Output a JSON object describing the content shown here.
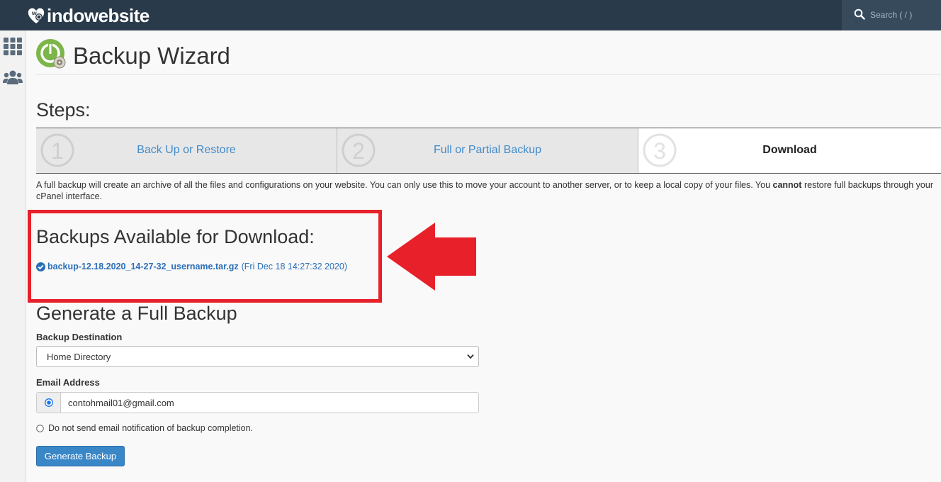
{
  "brand": {
    "name": "indowebsite"
  },
  "search": {
    "placeholder": "Search ( / )"
  },
  "sidebar": {
    "items": [
      {
        "icon": "apps-grid-icon"
      },
      {
        "icon": "users-icon"
      }
    ]
  },
  "page": {
    "title": "Backup Wizard"
  },
  "steps": {
    "heading": "Steps:",
    "items": [
      {
        "number": "1",
        "label": "Back Up or Restore",
        "active": false
      },
      {
        "number": "2",
        "label": "Full or Partial Backup",
        "active": false
      },
      {
        "number": "3",
        "label": "Download",
        "active": true
      }
    ]
  },
  "description": {
    "before": "A full backup will create an archive of all the files and configurations on your website. You can only use this to move your account to another server, or to keep a local copy of your files. You ",
    "emphasis": "cannot",
    "after": " restore full backups through your cPanel interface."
  },
  "available": {
    "heading": "Backups Available for Download:",
    "backups": [
      {
        "filename": "backup-12.18.2020_14-27-32_username.tar.gz",
        "date": "(Fri Dec 18 14:27:32 2020)"
      }
    ]
  },
  "generate": {
    "heading": "Generate a Full Backup",
    "destination_label": "Backup Destination",
    "destination_value": "Home Directory",
    "email_label": "Email Address",
    "email_value": "contohmail01@gmail.com",
    "no_email_label": "Do not send email notification of backup completion.",
    "button_label": "Generate Backup"
  },
  "colors": {
    "topbar": "#293a4a",
    "link": "#428bca",
    "highlight": "#e8202a",
    "button": "#3a87c8"
  }
}
